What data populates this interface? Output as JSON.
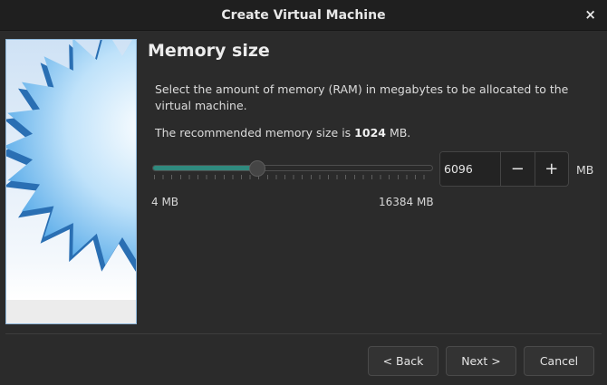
{
  "window": {
    "title": "Create Virtual Machine",
    "close_glyph": "×"
  },
  "page": {
    "heading": "Memory size",
    "description": "Select the amount of memory (RAM) in megabytes to be allocated to the virtual machine.",
    "recommended_prefix": "The recommended memory size is ",
    "recommended_value": "1024",
    "recommended_suffix": " MB."
  },
  "memory": {
    "value": "6096",
    "min": 4,
    "max": 16384,
    "min_label": "4 MB",
    "max_label": "16384 MB",
    "unit": "MB",
    "decrement_label": "−",
    "increment_label": "+"
  },
  "buttons": {
    "back": "< Back",
    "next": "Next >",
    "cancel": "Cancel"
  },
  "colors": {
    "accent": "#2f8a7e",
    "background": "#2b2b2b",
    "titlebar": "#1f1f1f"
  }
}
